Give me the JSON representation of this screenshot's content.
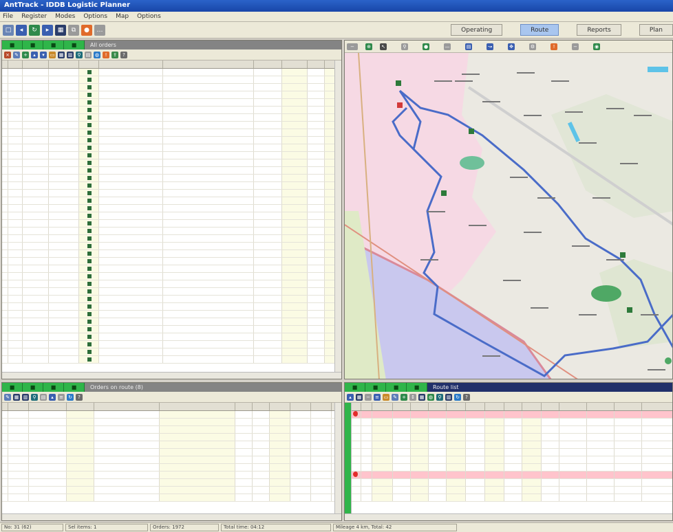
{
  "window": {
    "title": "AntTrack - IDDB Logistic Planner"
  },
  "menu": [
    "File",
    "Register",
    "Modes",
    "Options",
    "Map",
    "Options"
  ],
  "mode_tabs": [
    {
      "label": "Operating",
      "active": false
    },
    {
      "label": "Route",
      "active": true
    },
    {
      "label": "Reports",
      "active": false
    },
    {
      "label": "Plan",
      "active": false
    }
  ],
  "orders_panel": {
    "title": "All orders"
  },
  "routes_panel": {
    "title": "Orders on route (8)"
  },
  "route_points_panel": {
    "title": "Route list"
  },
  "status": [
    "No: 31 (62)",
    "Sel items: 1",
    "Orders: 1972",
    "Total time: 04:12",
    "Mileage 4 km, Total: 42"
  ],
  "colors": {
    "green_tab": "#2fb54a",
    "selected_row": "#ffc4cc",
    "route_line": "#4a6cc8",
    "map_pink": "#f6d9e4",
    "map_lake": "#c9c8ee"
  }
}
